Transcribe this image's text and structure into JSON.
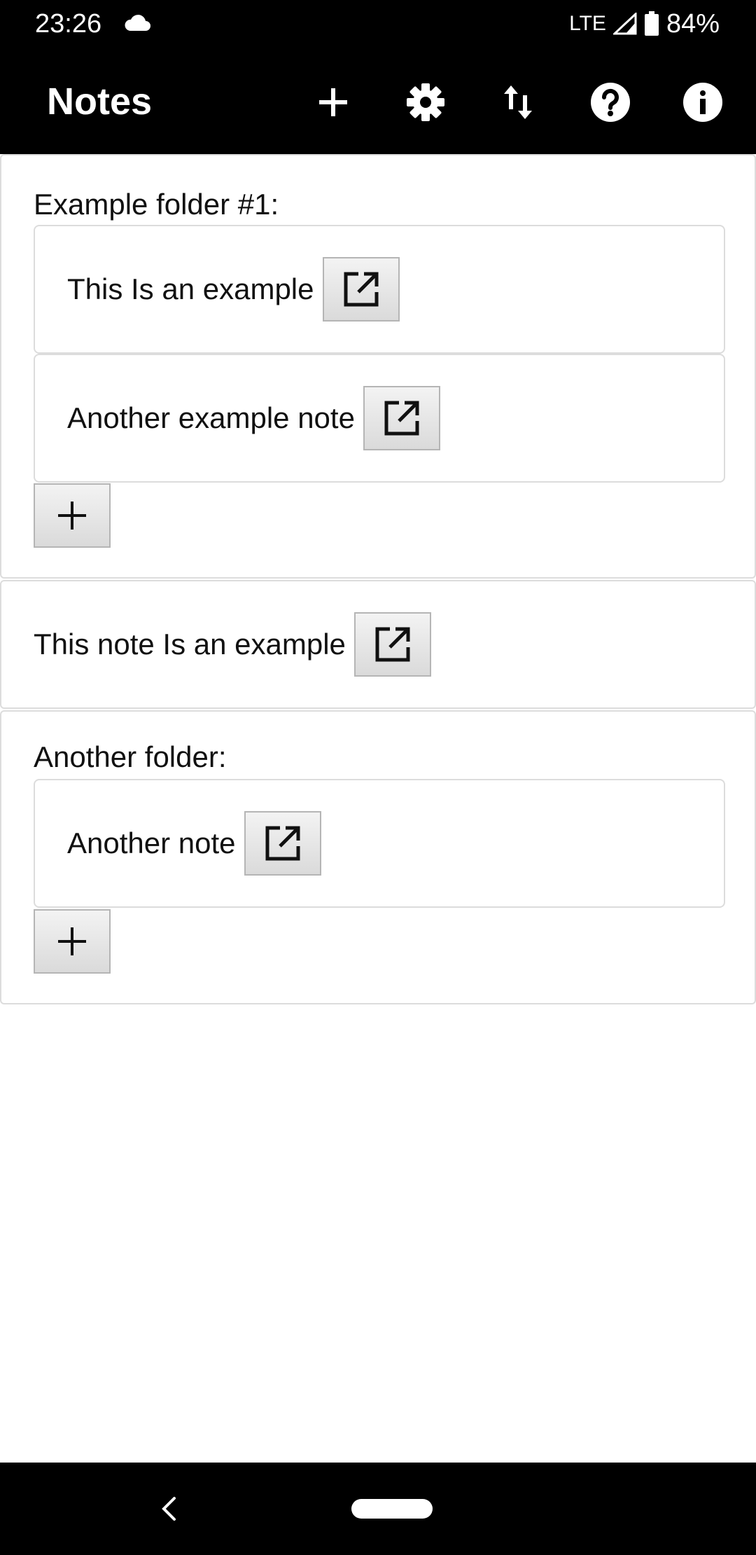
{
  "status_bar": {
    "time": "23:26",
    "network": "LTE",
    "battery": "84%"
  },
  "app_bar": {
    "title": "Notes",
    "actions": [
      "add-icon",
      "gear-icon",
      "sort-icon",
      "help-icon",
      "info-icon"
    ]
  },
  "folders": [
    {
      "title": "Example folder #1:",
      "notes": [
        {
          "label": "This Is an example"
        },
        {
          "label": "Another example note"
        }
      ]
    },
    {
      "title": "Another folder:",
      "notes": [
        {
          "label": "Another note"
        }
      ]
    }
  ],
  "standalone_note": {
    "label": "This note Is an example"
  },
  "icons": {
    "open": "open-in-new-icon",
    "add": "plus-icon",
    "back": "back-icon",
    "home": "home-pill"
  },
  "colors": {
    "bars": "#000000",
    "content_bg": "#ffffff",
    "border": "#dcdcdc",
    "button_border": "#b5b5b5"
  }
}
